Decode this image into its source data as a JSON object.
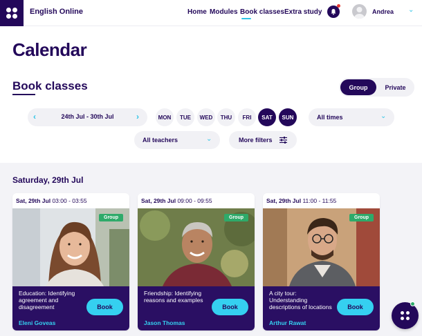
{
  "app": {
    "brand": "English Online"
  },
  "nav": {
    "home": "Home",
    "modules": "Modules",
    "book_classes": "Book classes",
    "extra_study": "Extra study"
  },
  "user": {
    "name": "Andrea"
  },
  "page": {
    "title": "Calendar",
    "section_title": "Book classes"
  },
  "class_type_toggle": {
    "group": "Group",
    "private": "Private",
    "selected": "Group"
  },
  "filters": {
    "date_range": "24th Jul - 30th Jul",
    "days": [
      {
        "label": "MON",
        "selected": false
      },
      {
        "label": "TUE",
        "selected": false
      },
      {
        "label": "WED",
        "selected": false
      },
      {
        "label": "THU",
        "selected": false
      },
      {
        "label": "FRI",
        "selected": false
      },
      {
        "label": "SAT",
        "selected": true
      },
      {
        "label": "SUN",
        "selected": true
      }
    ],
    "times": "All times",
    "teachers": "All teachers",
    "more_filters": "More filters"
  },
  "schedule": {
    "day_heading": "Saturday, 29th Jul",
    "cards": [
      {
        "date": "Sat, 29th Jul",
        "time": "03:00 - 03:55",
        "badge": "Group",
        "topic": "Education: Identifying agreement and disagreement",
        "teacher": "Eleni Goveas",
        "book_label": "Book"
      },
      {
        "date": "Sat, 29th Jul",
        "time": "09:00 - 09:55",
        "badge": "Group",
        "topic": "Friendship: Identifying reasons and examples",
        "teacher": "Jason Thomas",
        "book_label": "Book"
      },
      {
        "date": "Sat, 29th Jul",
        "time": "11:00 - 11:55",
        "badge": "Group",
        "topic": "A city tour: Understanding descriptions of locations",
        "teacher": "Arthur Rawat",
        "book_label": "Book"
      }
    ]
  },
  "colors": {
    "primary": "#23085a",
    "accent": "#35d0f0",
    "badge": "#2eaa6a",
    "card_footer": "#2a0f63"
  },
  "icons": [
    "logo-grid-icon",
    "bell-icon",
    "avatar-icon",
    "chevron-down-icon",
    "chevron-left-icon",
    "chevron-right-icon",
    "sliders-icon",
    "chat-icon"
  ]
}
